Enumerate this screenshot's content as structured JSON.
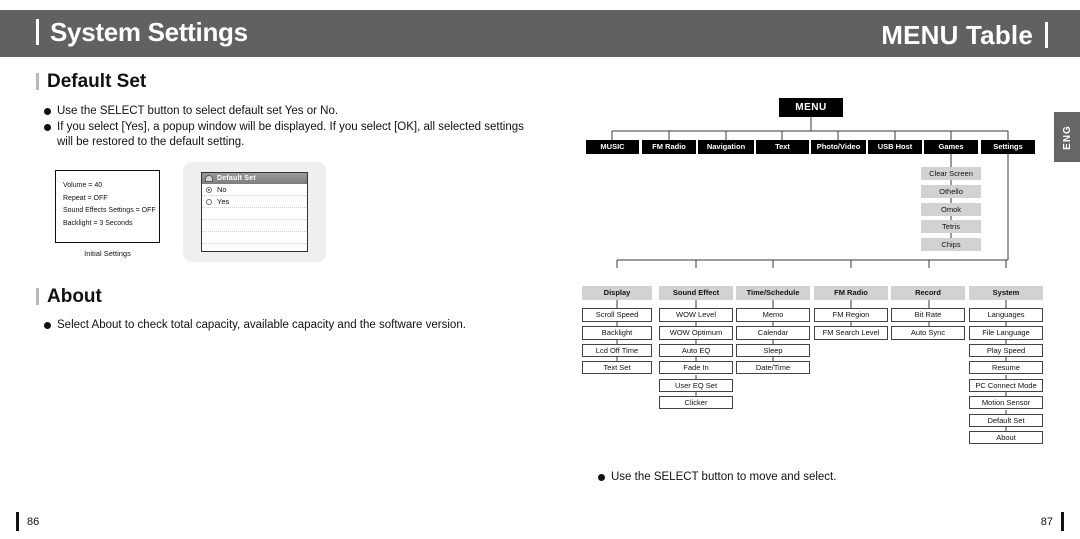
{
  "header": {
    "left_title": "System Settings",
    "right_title": "MENU Table"
  },
  "left_page": {
    "sections": [
      {
        "id": "default_set",
        "title": "Default Set"
      },
      {
        "id": "about",
        "title": "About"
      }
    ],
    "bullets": {
      "default_1": "Use the SELECT button to select default set Yes or No.",
      "default_2": "If you select [Yes], a popup window will be displayed. If you select [OK], all selected settings will be restored to the default setting.",
      "about_1": "Select About to check total capacity, available capacity and the software version."
    },
    "initial_settings": {
      "caption": "Initial Settings",
      "lines": [
        "Volume = 40",
        "Repeat = OFF",
        "Sound Effects Settings = OFF",
        "Backlight = 3 Seconds"
      ]
    },
    "device_popup": {
      "title": "Default Set",
      "options": [
        {
          "label": "No",
          "selected": true
        },
        {
          "label": "Yes",
          "selected": false
        }
      ]
    }
  },
  "right_page": {
    "eng_tab": "ENG",
    "note": "Use the SELECT button to move and select.",
    "menu_tree": {
      "root": "MENU",
      "level1": [
        "MUSIC",
        "FM Radio",
        "Navigation",
        "Text",
        "Photo/Video",
        "USB Host",
        "Games",
        "Settings"
      ],
      "games_children": [
        "Clear Screen",
        "Othello",
        "Omok",
        "Tetris",
        "Chips"
      ],
      "settings_children": [
        {
          "label": "Display",
          "items": [
            "Scroll Speed",
            "Backlight",
            "Lcd Off Time",
            "Text Set"
          ]
        },
        {
          "label": "Sound Effect",
          "items": [
            "WOW Level",
            "WOW Optimum",
            "Auto EQ",
            "Fade In",
            "User EQ Set",
            "Clicker"
          ]
        },
        {
          "label": "Time/Schedule",
          "items": [
            "Memo",
            "Calendar",
            "Sleep",
            "Date/Time"
          ]
        },
        {
          "label": "FM Radio",
          "items": [
            "FM Region",
            "FM Search Level"
          ]
        },
        {
          "label": "Record",
          "items": [
            "Bit Rate",
            "Auto Sync"
          ]
        },
        {
          "label": "System",
          "items": [
            "Languages",
            "File Language",
            "Play Speed",
            "Resume",
            "PC Connect Mode",
            "Motion Sensor",
            "Default Set",
            "About"
          ]
        }
      ]
    }
  },
  "footer": {
    "page_left": "86",
    "page_right": "87"
  },
  "colors": {
    "header_bg": "#616161",
    "node_level1_bg": "#000000",
    "node_level2_bg": "#d2d2d2",
    "device_shell": "#efefef"
  }
}
